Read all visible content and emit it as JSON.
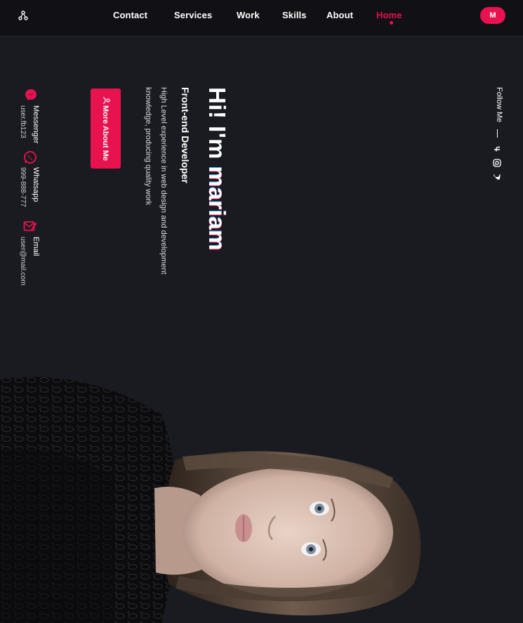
{
  "nav": {
    "items": [
      "Contact",
      "Services",
      "Work",
      "Skills",
      "About",
      "Home"
    ],
    "active": "Home",
    "avatar_letter": "M"
  },
  "hero": {
    "title_prefix": "Hi! I'm ",
    "title_name": "mariam",
    "subtitle": "Front-end Developer",
    "description_line1": "High Level experience in web design and development",
    "description_line2": "knowledge, producing quality work",
    "button_label": "More About Me"
  },
  "contacts": [
    {
      "label": "Messenger",
      "value": "user.fb123",
      "icon": "messenger-icon"
    },
    {
      "label": "Whatsapp",
      "value": "999-888-777",
      "icon": "whatsapp-icon"
    },
    {
      "label": "Email",
      "value": "user@mail.com",
      "icon": "email-icon"
    }
  ],
  "follow": {
    "label": "Follow Me",
    "socials": [
      "facebook-icon",
      "instagram-icon",
      "twitter-icon"
    ]
  },
  "colors": {
    "accent": "#e8124f",
    "background": "#1a1b20",
    "topbar": "#111115"
  }
}
